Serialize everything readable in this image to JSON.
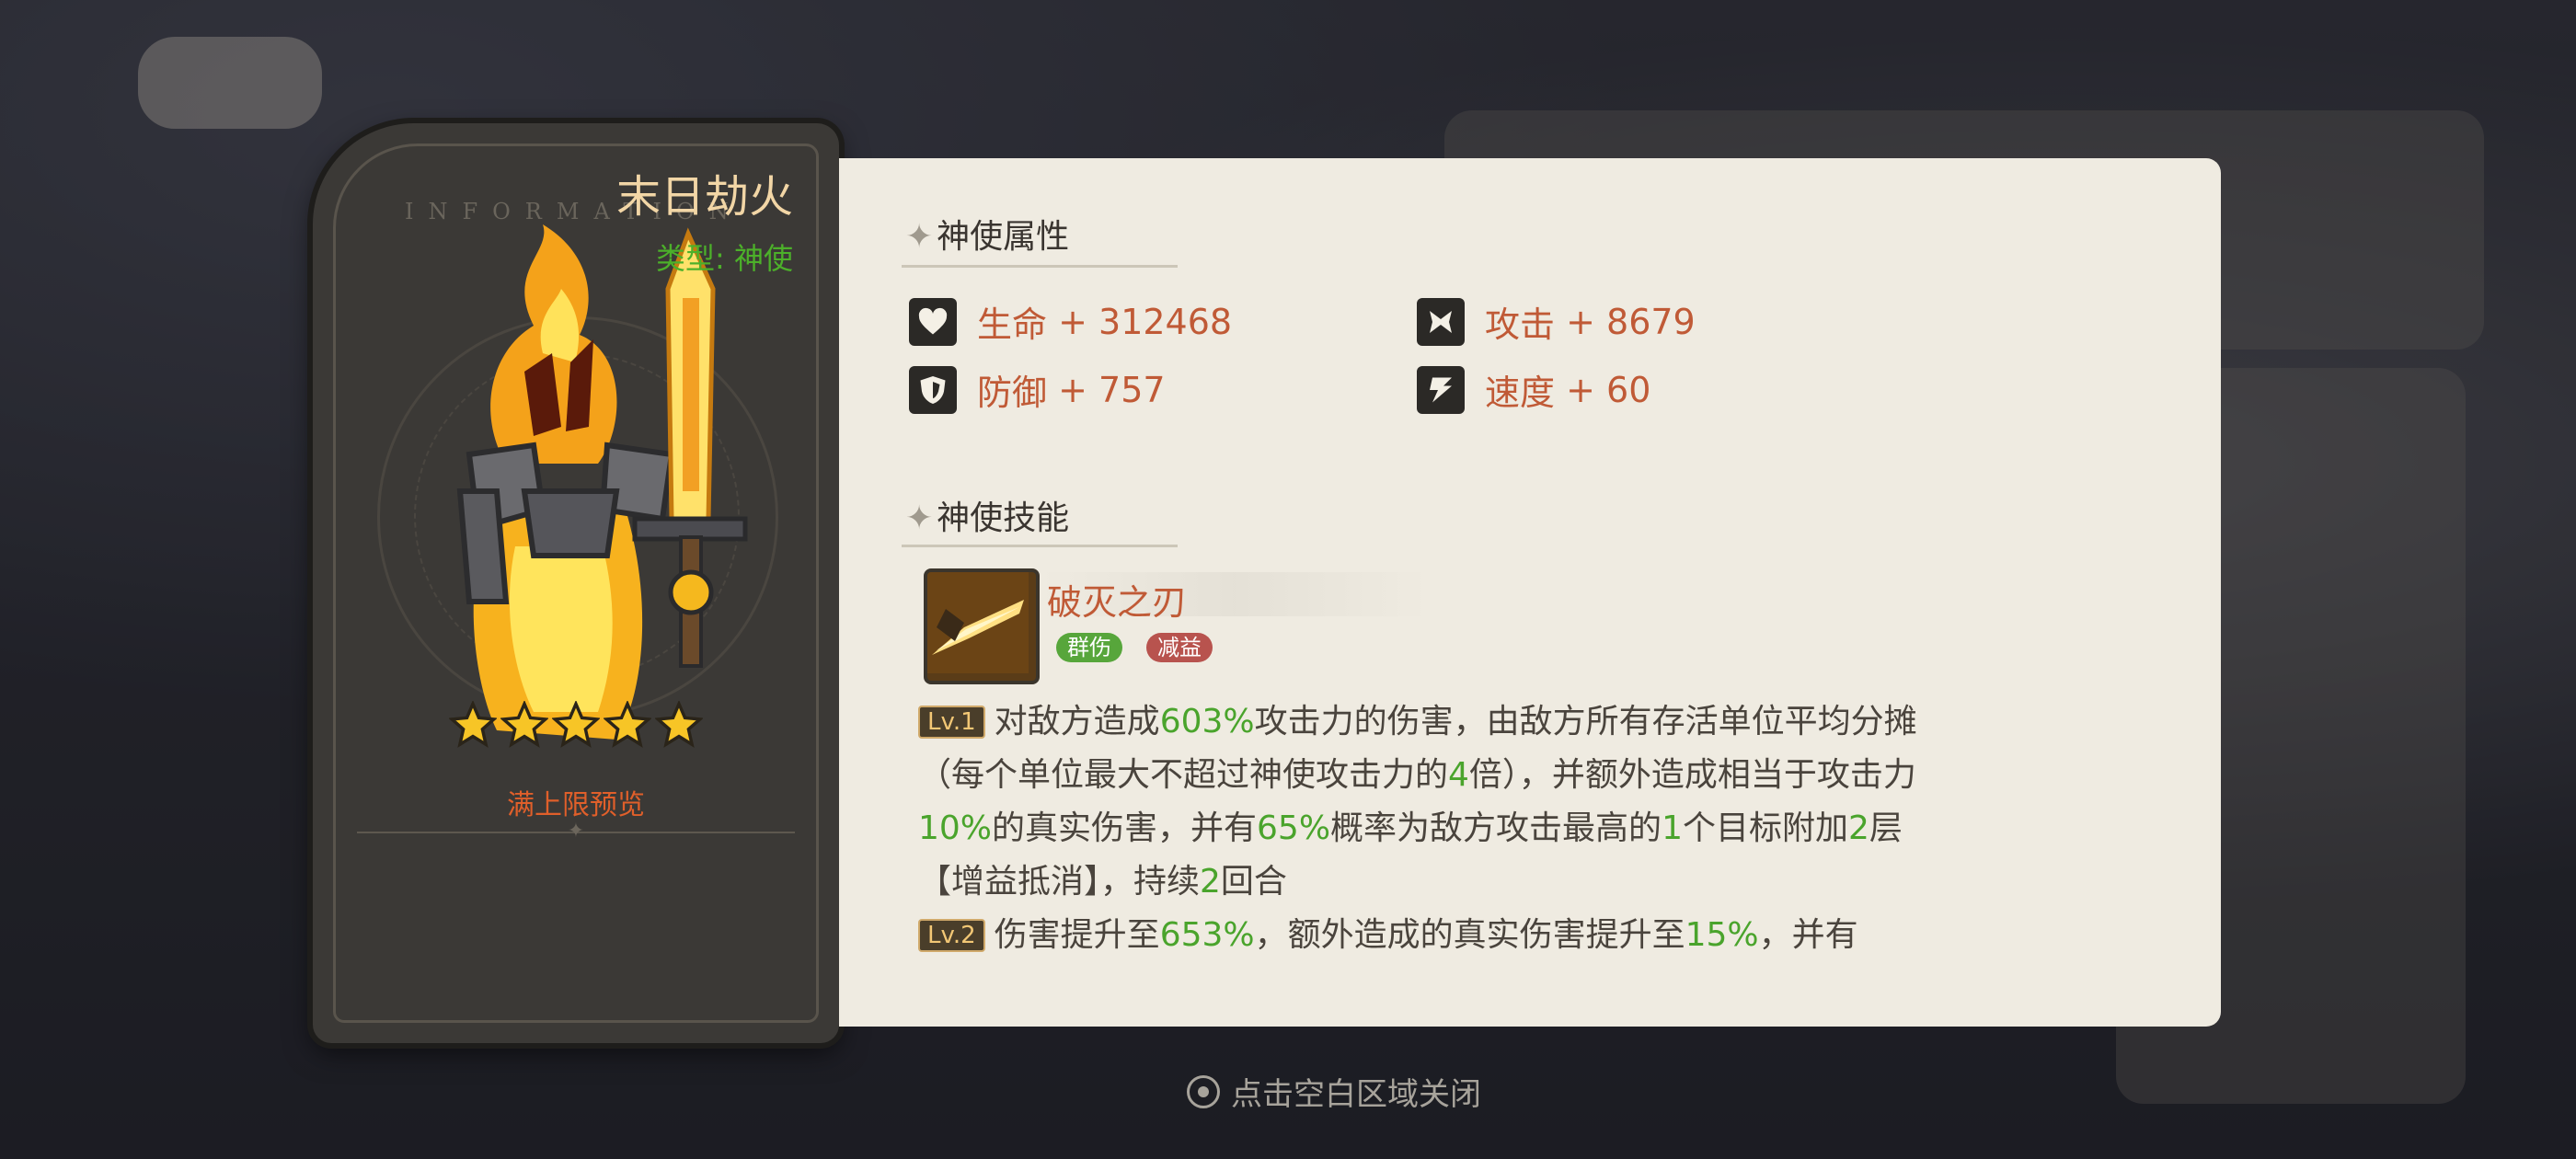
{
  "hero": {
    "name": "末日劫火",
    "type_label": "类型:",
    "type_value": "神使",
    "watermark": "INFORMATION",
    "star_count": 5,
    "preview_label": "满上限预览"
  },
  "attributes": {
    "title": "神使属性",
    "stats": [
      {
        "icon": "heart-icon",
        "label": "生命",
        "value": "+ 312468"
      },
      {
        "icon": "axe-icon",
        "label": "攻击",
        "value": "+ 8679"
      },
      {
        "icon": "shield-icon",
        "label": "防御",
        "value": "+ 757"
      },
      {
        "icon": "speed-icon",
        "label": "速度",
        "value": "+ 60"
      }
    ]
  },
  "skills": {
    "title": "神使技能",
    "skill_name": "破灭之刃",
    "tags": [
      "群伤",
      "减益"
    ],
    "levels": [
      {
        "badge": "Lv.1",
        "parts": [
          "对敌方造成",
          "603%",
          "攻击力的伤害，由敌方所有存活单位平均分摊（每个单位最大不超过神使攻击力的",
          "4",
          "倍），并额外造成相当于攻击力",
          "10%",
          "的真实伤害，并有",
          "65%",
          "概率为敌方攻击最高的",
          "1",
          "个目标附加",
          "2",
          "层【增益抵消】，持续",
          "2",
          "回合"
        ]
      },
      {
        "badge": "Lv.2",
        "parts": [
          "伤害提升至",
          "653%",
          "，额外造成的真实伤害提升至",
          "15%",
          "，并有"
        ]
      }
    ]
  },
  "footer": {
    "close_hint": "点击空白区域关闭"
  },
  "colors": {
    "accent_text": "#c05a36",
    "highlight_green": "#4aa42c",
    "panel_bg": "#efebe1",
    "card_bg": "#3b3936"
  }
}
